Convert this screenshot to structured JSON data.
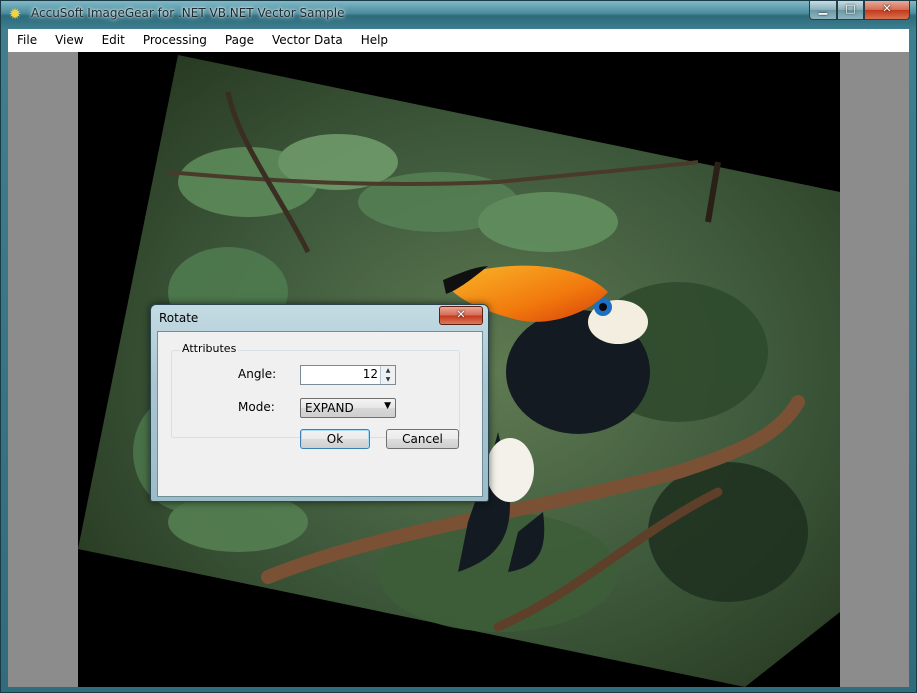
{
  "window": {
    "title": "AccuSoft ImageGear for .NET VB.NET Vector Sample",
    "icon": "gear-icon",
    "controls": {
      "minimize": "minimize-icon",
      "maximize": "maximize-icon",
      "close": "close-icon"
    }
  },
  "menu": [
    "File",
    "View",
    "Edit",
    "Processing",
    "Page",
    "Vector Data",
    "Help"
  ],
  "document": {
    "rotation_degrees": 12,
    "content": "photo of a toucan on a branch"
  },
  "dialog": {
    "title": "Rotate",
    "group_label": "Attributes",
    "angle_label": "Angle:",
    "angle_value": "12",
    "mode_label": "Mode:",
    "mode_value": "EXPAND",
    "ok_label": "Ok",
    "cancel_label": "Cancel"
  },
  "colors": {
    "workspace_gray": "#8c8c8c",
    "titlebar_teal": "#3b7c8d",
    "beak_orange": "#f08a10"
  }
}
